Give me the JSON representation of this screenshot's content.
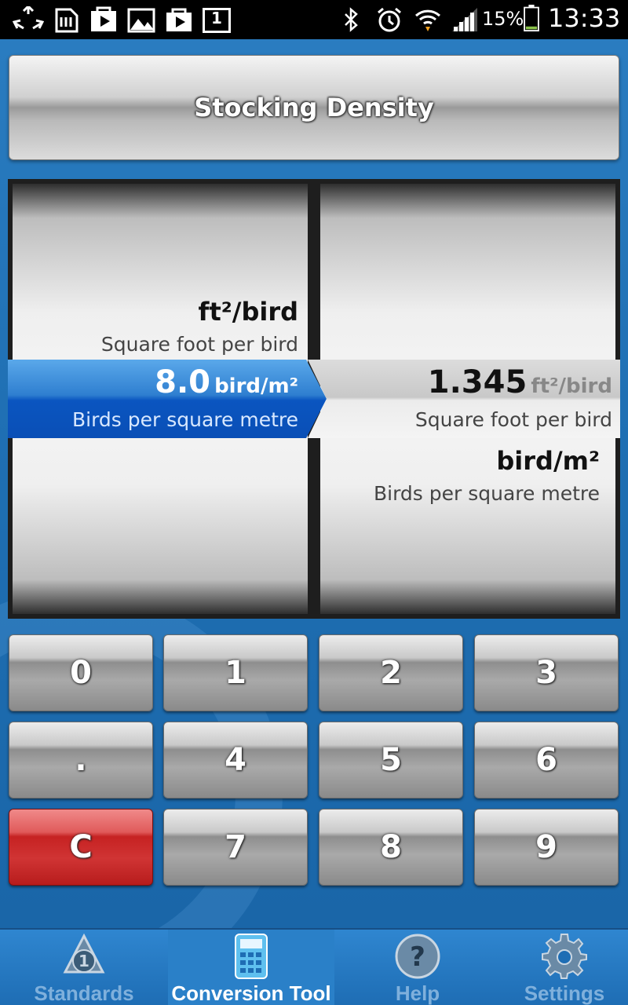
{
  "status_bar": {
    "battery": "15%",
    "time": "13:33",
    "icons": [
      "recycle-icon",
      "sd-card-icon",
      "play-store-icon",
      "gallery-icon",
      "shopping-bag-icon",
      "notification-1-icon",
      "bluetooth-icon",
      "alarm-icon",
      "wifi-icon",
      "signal-icon",
      "battery-icon"
    ],
    "notification_count": "1"
  },
  "title": "Stocking Density",
  "picker": {
    "left_above": {
      "unit": "ft²/bird",
      "desc": "Square foot per bird"
    },
    "left_selected": {
      "value": "8.0",
      "unit": "bird/m²",
      "desc": "Birds per square metre"
    },
    "right_selected": {
      "value": "1.345",
      "unit": "ft²/bird",
      "desc": "Square foot per bird"
    },
    "right_below": {
      "unit": "bird/m²",
      "desc": "Birds per square metre"
    }
  },
  "keypad": {
    "keys": [
      "0",
      "1",
      "2",
      "3",
      ".",
      "4",
      "5",
      "6",
      "C",
      "7",
      "8",
      "9"
    ]
  },
  "nav": {
    "items": [
      {
        "label": "Standards",
        "icon": "standards-icon"
      },
      {
        "label": "Conversion Tool",
        "icon": "calculator-icon"
      },
      {
        "label": "Help",
        "icon": "help-icon"
      },
      {
        "label": "Settings",
        "icon": "gear-icon"
      }
    ],
    "active": "Conversion Tool"
  },
  "colors": {
    "background": "#1f6fb3",
    "selection_blue": "#0a55c0",
    "clear_red": "#c62222"
  }
}
